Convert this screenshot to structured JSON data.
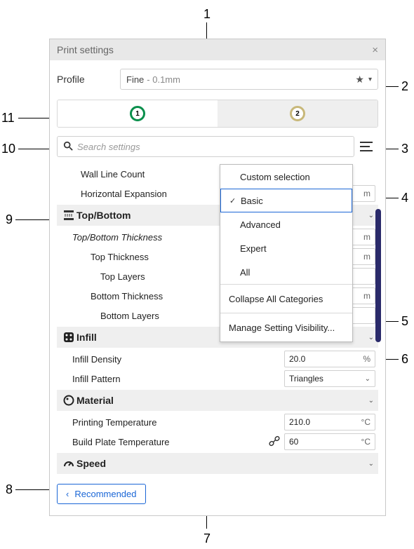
{
  "callouts": {
    "c1": "1",
    "c2": "2",
    "c3": "3",
    "c4": "4",
    "c5": "5",
    "c6": "6",
    "c7": "7",
    "c8": "8",
    "c9": "9",
    "c10": "10",
    "c11": "11"
  },
  "panel": {
    "title": "Print settings"
  },
  "profile": {
    "label": "Profile",
    "name": "Fine",
    "detail": "- 0.1mm"
  },
  "tabs": {
    "ext1": "1",
    "ext2": "2"
  },
  "search": {
    "placeholder": "Search settings"
  },
  "rows": {
    "wall_line_count": "Wall Line Count",
    "horizontal_expansion": "Horizontal Expansion",
    "horizontal_expansion_unit": "m",
    "top_bottom_thickness": "Top/Bottom Thickness",
    "top_thickness": "Top Thickness",
    "top_layers": "Top Layers",
    "bottom_thickness": "Bottom Thickness",
    "bottom_layers": "Bottom Layers",
    "unit_mm_stub": "m",
    "infill_density": "Infill Density",
    "infill_density_val": "20.0",
    "infill_density_unit": "%",
    "infill_pattern": "Infill Pattern",
    "infill_pattern_val": "Triangles",
    "printing_temp": "Printing Temperature",
    "printing_temp_val": "210.0",
    "printing_temp_unit": "°C",
    "build_plate_temp": "Build Plate Temperature",
    "build_plate_temp_val": "60",
    "build_plate_temp_unit": "°C"
  },
  "cats": {
    "top_bottom": "Top/Bottom",
    "infill": "Infill",
    "material": "Material",
    "speed": "Speed"
  },
  "menu": {
    "custom": "Custom selection",
    "basic": "Basic",
    "advanced": "Advanced",
    "expert": "Expert",
    "all": "All",
    "collapse": "Collapse All Categories",
    "manage": "Manage Setting Visibility..."
  },
  "footer": {
    "recommended": "Recommended"
  }
}
